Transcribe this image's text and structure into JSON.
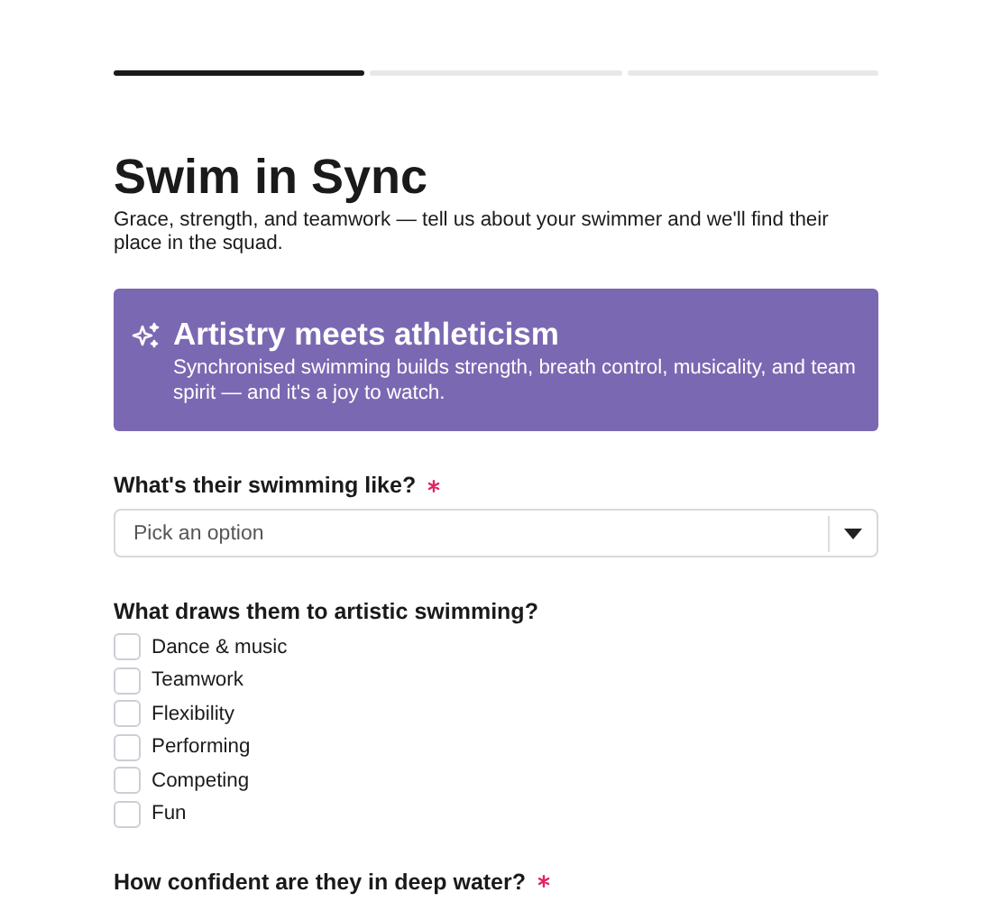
{
  "progress": [
    {
      "done": true
    },
    {
      "done": false
    },
    {
      "done": false
    }
  ],
  "title": "Swim in Sync",
  "subtitle": "Grace, strength, and teamwork — tell us about your swimmer and we'll find their place in the squad.",
  "callout": {
    "title": "Artistry meets athleticism",
    "text": "Synchronised swimming builds strength, breath control, musicality, and team spirit — and it's a joy to watch."
  },
  "questions": [
    {
      "kind": "select",
      "label": "What's their swimming like?",
      "required": true,
      "placeholder": "Pick an option"
    },
    {
      "kind": "checkboxes",
      "label": "What draws them to artistic swimming?",
      "required": false,
      "options": [
        {
          "label": "Dance & music",
          "checked": false
        },
        {
          "label": "Teamwork",
          "checked": false
        },
        {
          "label": "Flexibility",
          "checked": false
        },
        {
          "label": "Performing",
          "checked": false
        },
        {
          "label": "Competing",
          "checked": false
        },
        {
          "label": "Fun",
          "checked": false
        }
      ]
    },
    {
      "kind": "heading",
      "label": "How confident are they in deep water?",
      "required": true
    }
  ]
}
